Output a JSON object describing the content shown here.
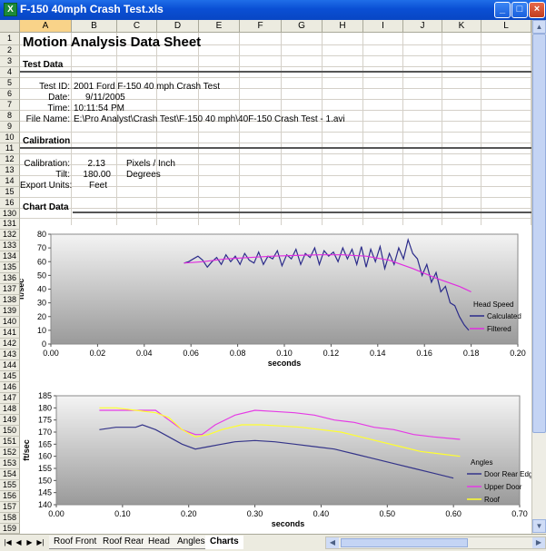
{
  "window": {
    "title": "F-150 40mph Crash Test.xls",
    "app_icon": "excel-icon",
    "buttons": {
      "minimize": "_",
      "maximize": "□",
      "close": "×"
    }
  },
  "columns": [
    "A",
    "B",
    "C",
    "D",
    "E",
    "F",
    "G",
    "H",
    "I",
    "J",
    "K",
    "L"
  ],
  "selected_column": "A",
  "rows": [
    "1",
    "2",
    "3",
    "4",
    "5",
    "6",
    "7",
    "8",
    "9",
    "10",
    "11",
    "12",
    "13",
    "14",
    "15",
    "16",
    "130",
    "131",
    "132",
    "133",
    "134",
    "135",
    "136",
    "137",
    "138",
    "139",
    "140",
    "141",
    "142",
    "143",
    "144",
    "145",
    "146",
    "147",
    "148",
    "149",
    "150",
    "151",
    "152",
    "153",
    "154",
    "155",
    "156",
    "157",
    "158",
    "159"
  ],
  "sheet": {
    "title": "Motion Analysis Data Sheet",
    "test_data_header": "Test Data",
    "test_id_label": "Test ID:",
    "test_id_value": "2001 Ford F-150 40 mph Crash Test",
    "date_label": "Date:",
    "date_value": "9/11/2005",
    "time_label": "Time:",
    "time_value": "10:11:54 PM",
    "file_label": "File Name:",
    "file_value": "E:\\Pro Analyst\\Crash Test\\F-150 40 mph\\40F-150 Crash Test - 1.avi",
    "calibration_header": "Calibration",
    "calibration_label": "Calibration:",
    "calibration_value": "2.13",
    "calibration_unit": "Pixels / Inch",
    "tilt_label": "Tilt:",
    "tilt_value": "180.00",
    "tilt_unit": "Degrees",
    "export_label": "Export Units:",
    "export_value": "Feet",
    "chart_data_header": "Chart Data"
  },
  "tabs": {
    "nav": [
      "|◀",
      "◀",
      "▶",
      "▶|"
    ],
    "sheets": [
      "Roof Front",
      "Roof Rear",
      "Head",
      "Angles",
      "Charts"
    ],
    "active": "Charts"
  },
  "colors": {
    "calculated": "#2b2b8a",
    "filtered": "#e02ce0",
    "door_rear_edge": "#343489",
    "upper_door": "#e53be5",
    "roof": "#ffff2e",
    "plot_bg_top": "#f4f4f4",
    "plot_bg_bottom": "#9a9a9a"
  },
  "chart_data": [
    {
      "type": "line",
      "title": "",
      "xlabel": "seconds",
      "ylabel": "ft/sec",
      "xlim": [
        0,
        0.2
      ],
      "ylim": [
        0,
        80
      ],
      "x_ticks": [
        "0.00",
        "0.02",
        "0.04",
        "0.06",
        "0.08",
        "0.10",
        "0.12",
        "0.14",
        "0.16",
        "0.18",
        "0.20"
      ],
      "y_ticks": [
        "0",
        "10",
        "20",
        "30",
        "40",
        "50",
        "60",
        "70",
        "80"
      ],
      "legend_title": "Head Speed",
      "legend_position": "right",
      "grid": false,
      "series": [
        {
          "name": "Calculated",
          "x": [
            0.057,
            0.059,
            0.061,
            0.063,
            0.065,
            0.067,
            0.069,
            0.071,
            0.073,
            0.075,
            0.077,
            0.079,
            0.081,
            0.083,
            0.085,
            0.087,
            0.089,
            0.091,
            0.093,
            0.095,
            0.097,
            0.099,
            0.101,
            0.103,
            0.105,
            0.107,
            0.109,
            0.111,
            0.113,
            0.115,
            0.117,
            0.119,
            0.121,
            0.123,
            0.125,
            0.127,
            0.129,
            0.131,
            0.133,
            0.135,
            0.137,
            0.139,
            0.141,
            0.143,
            0.145,
            0.147,
            0.149,
            0.151,
            0.153,
            0.155,
            0.157,
            0.159,
            0.161,
            0.163,
            0.165,
            0.167,
            0.169,
            0.171,
            0.173,
            0.175,
            0.177,
            0.179
          ],
          "values": [
            59,
            60,
            62,
            64,
            61,
            56,
            60,
            63,
            58,
            65,
            60,
            64,
            58,
            66,
            61,
            59,
            67,
            58,
            64,
            62,
            68,
            57,
            65,
            62,
            69,
            58,
            66,
            63,
            70,
            58,
            68,
            64,
            67,
            60,
            70,
            62,
            69,
            58,
            71,
            56,
            69,
            60,
            71,
            55,
            66,
            58,
            70,
            62,
            76,
            66,
            62,
            50,
            58,
            45,
            52,
            38,
            42,
            30,
            28,
            20,
            14,
            10
          ]
        },
        {
          "name": "Filtered",
          "x": [
            0.057,
            0.065,
            0.075,
            0.085,
            0.095,
            0.105,
            0.115,
            0.125,
            0.135,
            0.145,
            0.155,
            0.165,
            0.175,
            0.18
          ],
          "values": [
            59,
            60,
            62,
            63,
            64,
            64.5,
            65,
            65,
            64,
            61,
            55,
            48,
            42,
            38
          ]
        }
      ]
    },
    {
      "type": "line",
      "title": "",
      "xlabel": "seconds",
      "ylabel": "ft/sec",
      "xlim": [
        0,
        0.7
      ],
      "ylim": [
        140,
        185
      ],
      "x_ticks": [
        "0.00",
        "0.10",
        "0.20",
        "0.30",
        "0.40",
        "0.50",
        "0.60",
        "0.70"
      ],
      "y_ticks": [
        "140",
        "145",
        "150",
        "155",
        "160",
        "165",
        "170",
        "175",
        "180",
        "185"
      ],
      "legend_title": "Angles",
      "legend_position": "right",
      "grid": false,
      "series": [
        {
          "name": "Door Rear Edge",
          "x": [
            0.065,
            0.09,
            0.12,
            0.13,
            0.15,
            0.17,
            0.19,
            0.21,
            0.23,
            0.25,
            0.27,
            0.3,
            0.33,
            0.36,
            0.39,
            0.42,
            0.45,
            0.48,
            0.51,
            0.54,
            0.57,
            0.6
          ],
          "values": [
            171,
            172,
            172,
            173,
            171,
            168,
            165,
            163,
            164,
            165,
            166,
            166.5,
            166,
            165,
            164,
            163,
            161,
            159,
            157,
            155,
            153,
            151
          ]
        },
        {
          "name": "Upper Door",
          "x": [
            0.065,
            0.09,
            0.12,
            0.15,
            0.17,
            0.19,
            0.21,
            0.22,
            0.24,
            0.27,
            0.3,
            0.33,
            0.36,
            0.39,
            0.42,
            0.45,
            0.48,
            0.51,
            0.54,
            0.57,
            0.61
          ],
          "values": [
            179,
            179,
            179,
            179,
            175,
            171,
            169,
            169,
            173,
            177,
            179,
            178.5,
            178,
            177,
            175,
            174,
            172,
            171,
            169,
            168,
            167
          ]
        },
        {
          "name": "Roof",
          "x": [
            0.065,
            0.09,
            0.12,
            0.15,
            0.17,
            0.19,
            0.21,
            0.23,
            0.25,
            0.28,
            0.31,
            0.34,
            0.37,
            0.4,
            0.43,
            0.46,
            0.49,
            0.52,
            0.55,
            0.58,
            0.61
          ],
          "values": [
            180,
            180,
            179,
            178,
            176,
            171,
            168,
            169,
            171,
            173,
            173,
            172.5,
            172,
            171,
            170,
            168,
            166,
            164,
            162,
            161,
            160
          ]
        }
      ]
    }
  ]
}
